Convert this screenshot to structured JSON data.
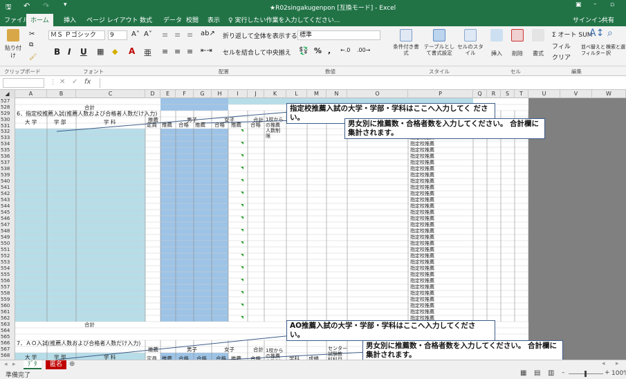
{
  "window": {
    "title": "★R02singakugenpon [互換モード] - Excel",
    "sign_in": "サインイン",
    "share": "共有"
  },
  "quick_access": {
    "save_icon": "save-icon",
    "undo_icon": "undo-icon",
    "redo_icon": "redo-icon"
  },
  "tabs": [
    {
      "label": "ファイル"
    },
    {
      "label": "ホーム"
    },
    {
      "label": "挿入"
    },
    {
      "label": "ページ レイアウト"
    },
    {
      "label": "数式"
    },
    {
      "label": "データ"
    },
    {
      "label": "校閲"
    },
    {
      "label": "表示"
    },
    {
      "label": "♀ 実行したい作業を入力してください..."
    }
  ],
  "ribbon": {
    "paste": "貼り付け",
    "font_name": "ＭＳ Ｐゴシック",
    "font_size": "9",
    "wrap_text": "折り返して全体を表示する",
    "merge_center": "セルを結合して中央揃え",
    "number_format": "標準",
    "cond_format": "条件付き書式",
    "table_format": "テーブルとして書式設定",
    "cell_style": "セルのスタイル",
    "insert": "挿入",
    "delete": "削除",
    "format": "書式",
    "autosum": "Σ オート SUM",
    "fill": "フィル",
    "clear": "クリア",
    "sort_filter": "並べ替えとフィルター",
    "find_select": "検索と選択",
    "bold": "B",
    "italic": "I",
    "underline": "U",
    "percent": "%",
    "comma": ","
  },
  "group_labels": [
    "クリップボード",
    "フォント",
    "配置",
    "数値",
    "スタイル",
    "セル",
    "編集"
  ],
  "formula_bar": {
    "name_box": "",
    "fx": "fx",
    "content": ""
  },
  "columns": [
    "A",
    "B",
    "C",
    "D",
    "E",
    "F",
    "G",
    "H",
    "I",
    "J",
    "K",
    "L",
    "M",
    "N",
    "O",
    "P",
    "Q",
    "R",
    "S",
    "T",
    "U",
    "V",
    "W"
  ],
  "rows": [
    "527",
    "528",
    "529",
    "530",
    "531",
    "532",
    "533",
    "534",
    "535",
    "536",
    "537",
    "538",
    "539",
    "540",
    "541",
    "542",
    "543",
    "544",
    "545",
    "546",
    "547",
    "548",
    "549",
    "550",
    "551",
    "552",
    "553",
    "554",
    "555",
    "556",
    "557",
    "558",
    "559",
    "560",
    "561",
    "562",
    "563",
    "564",
    "565",
    "566",
    "567",
    "568"
  ],
  "sheet": {
    "sec6_title": "6．指定校推薦入試(推薦人数および合格者人数だけ入力)",
    "sec7_title": "7．ＡＯ入試(推薦人数および合格者人数だけ入力)",
    "gokei": "合計",
    "hdr_daigaku": "大 学",
    "hdr_gakubu": "学 部",
    "hdr_gakka": "学 科",
    "hdr_suisen": "推薦",
    "hdr_danshi": "男子",
    "hdr_joshi": "女子",
    "hdr_gokei": "合計",
    "hdr_teiin": "定員",
    "hdr_gokaku": "合格",
    "hdr_ikko": "1校から の推薦 人数制 限",
    "hdr_gakka2": "学科",
    "hdr_seiseki": "成績",
    "hdr_center": "センター 試験教 科科目",
    "shiteiko": "指定校推薦",
    "col_q_a": "者",
    "col_q_b": "数"
  },
  "callouts": {
    "c1": "指定校推薦入試の大学・学部・学科はここへ入力してく ださい。",
    "c2": "男女別に推薦数・合格者数を入力してください。 合計欄に集計されます。",
    "c3": "AO推薦入試の大学・学部・学科はここへ入力してくださ い。",
    "c4": "男女別に推薦数・合格者数を入力してください。 合計欄に集計されます。"
  },
  "sheet_tabs": [
    {
      "label": "ﾃﾞﾀ"
    },
    {
      "label": "匿名"
    }
  ],
  "status": {
    "ready": "準備完了",
    "zoom": "100%"
  },
  "colors": {
    "excel_green": "#217346",
    "teal": "#b7dde8",
    "blue": "#9dc3e6",
    "grey": "#808080",
    "tab_red": "#c00000"
  }
}
